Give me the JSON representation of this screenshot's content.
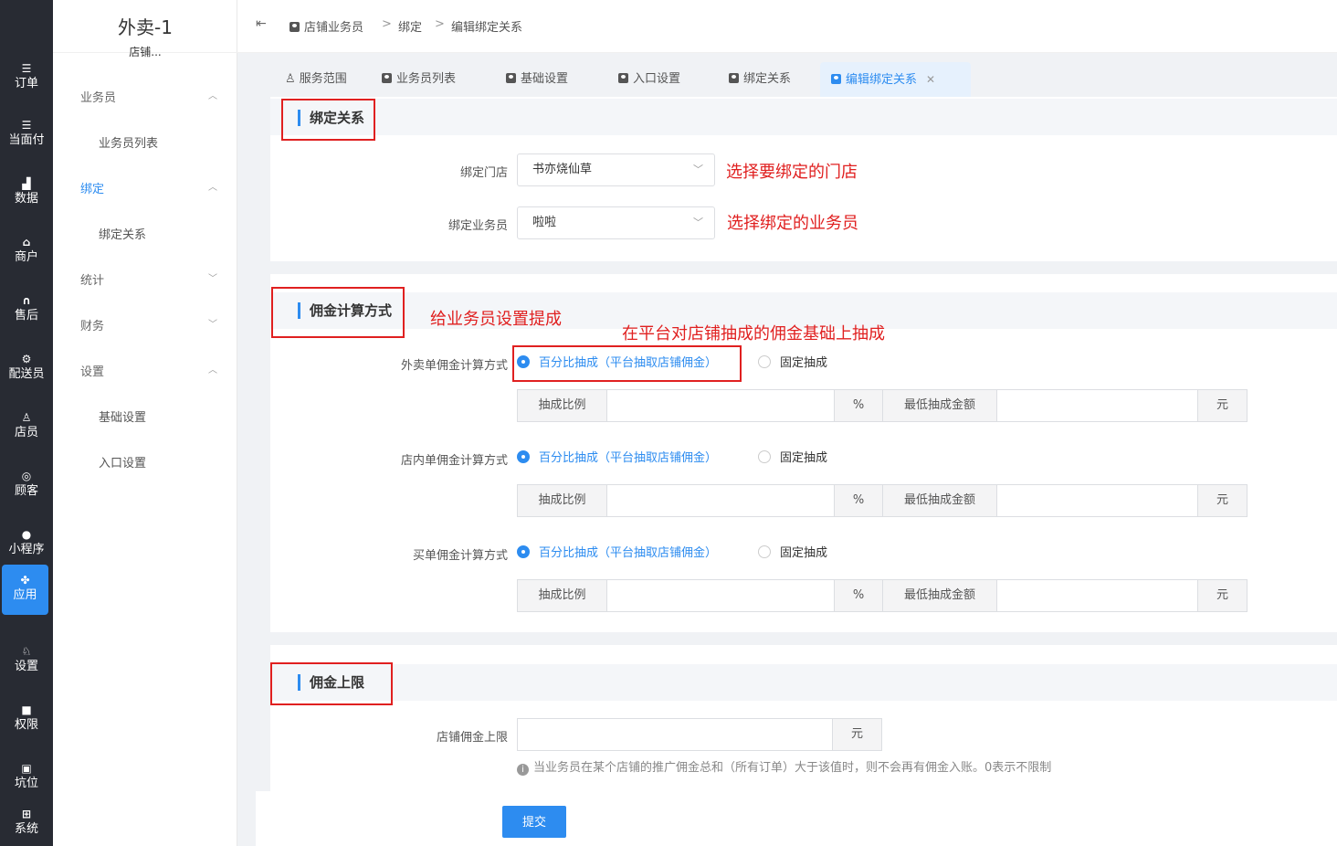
{
  "leftnav": {
    "items": [
      {
        "label": "订单",
        "icon": "list-icon"
      },
      {
        "label": "当面付",
        "icon": "list-icon"
      },
      {
        "label": "数据",
        "icon": "bar-chart-icon"
      },
      {
        "label": "商户",
        "icon": "shop-icon"
      },
      {
        "label": "售后",
        "icon": "headset-icon"
      },
      {
        "label": "配送员",
        "icon": "scooter-icon"
      },
      {
        "label": "店员",
        "icon": "users-icon"
      },
      {
        "label": "顾客",
        "icon": "customer-icon"
      },
      {
        "label": "小程序",
        "icon": "wechat-icon"
      },
      {
        "label": "应用",
        "icon": "apps-icon"
      },
      {
        "label": "设置",
        "icon": "settings-icon"
      },
      {
        "label": "权限",
        "icon": "lock-icon"
      },
      {
        "label": "坑位",
        "icon": "slot-icon"
      },
      {
        "label": "系统",
        "icon": "windows-icon"
      }
    ],
    "active": "应用",
    "accent": "#2d8cf0"
  },
  "sidebar": {
    "brand": "外卖-1",
    "brand_sub": "店铺...",
    "groups": [
      {
        "label": "业务员",
        "chevron": "up"
      },
      {
        "label": "业务员列表"
      },
      {
        "label": "绑定",
        "chevron": "up"
      },
      {
        "label": "绑定关系"
      },
      {
        "label": "统计",
        "chevron": "down"
      },
      {
        "label": "财务",
        "chevron": "down"
      },
      {
        "label": "设置",
        "chevron": "up"
      },
      {
        "label": "基础设置"
      },
      {
        "label": "入口设置"
      }
    ]
  },
  "breadcrumb": [
    "店铺业务员",
    "绑定",
    "编辑绑定关系"
  ],
  "tabs": [
    {
      "label": "服务范围"
    },
    {
      "label": "业务员列表"
    },
    {
      "label": "基础设置"
    },
    {
      "label": "入口设置"
    },
    {
      "label": "绑定关系"
    },
    {
      "label": "编辑绑定关系",
      "active": true
    }
  ],
  "bind_section": {
    "title": "绑定关系",
    "store_label": "绑定门店",
    "store_value": "书亦烧仙草",
    "staff_label": "绑定业务员",
    "staff_value": "啦啦",
    "anno_store": "选择要绑定的门店",
    "anno_staff": "选择绑定的业务员"
  },
  "commission_section": {
    "title": "佣金计算方式",
    "anno_title": "给业务员设置提成",
    "anno_radio": "在平台对店铺抽成的佣金基础上抽成",
    "rows": [
      {
        "label": "外卖单佣金计算方式"
      },
      {
        "label": "店内单佣金计算方式"
      },
      {
        "label": "买单佣金计算方式"
      }
    ],
    "opt_percent": "百分比抽成（平台抽取店铺佣金）",
    "opt_fixed": "固定抽成",
    "ratio_label": "抽成比例",
    "percent_unit": "%",
    "min_label": "最低抽成金额",
    "yuan_unit": "元"
  },
  "limit_section": {
    "title": "佣金上限",
    "label": "店铺佣金上限",
    "unit": "元",
    "hint": "当业务员在某个店铺的推广佣金总和（所有订单）大于该值时，则不会再有佣金入账。0表示不限制",
    "info_icon": "info-icon"
  },
  "submit_label": "提交"
}
